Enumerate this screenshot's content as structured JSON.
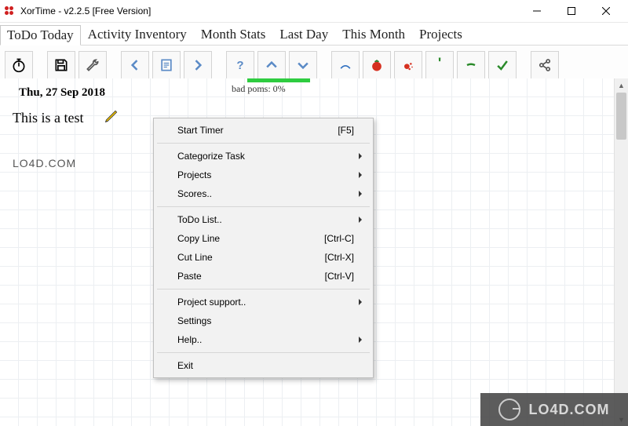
{
  "window": {
    "title": "XorTime - v2.2.5 [Free Version]"
  },
  "tabs": [
    {
      "label": "ToDo Today",
      "active": true
    },
    {
      "label": "Activity Inventory",
      "active": false
    },
    {
      "label": "Month Stats",
      "active": false
    },
    {
      "label": "Last Day",
      "active": false
    },
    {
      "label": "This Month",
      "active": false
    },
    {
      "label": "Projects",
      "active": false
    }
  ],
  "toolbar": {
    "timer": "timer-icon",
    "save": "save-icon",
    "settings": "wrench-icon",
    "prev": "prev-icon",
    "today": "today-icon",
    "next": "next-icon",
    "help": "help-icon",
    "up": "up-icon",
    "down": "down-icon",
    "void": "void-icon",
    "pom": "tomato-icon",
    "bad": "bad-icon",
    "int": "internal-icon",
    "ext": "external-icon",
    "done": "done-icon",
    "share": "share-icon"
  },
  "canvas": {
    "date": "Thu, 27 Sep 2018",
    "task": "This is a test",
    "watermark": "LO4D.COM",
    "poms_label": "bad poms: 0%"
  },
  "context_menu": {
    "items": [
      {
        "label": "Start Timer",
        "accel": "[F5]",
        "type": "item"
      },
      {
        "type": "sep"
      },
      {
        "label": "Categorize Task",
        "type": "sub"
      },
      {
        "label": "Projects",
        "type": "sub"
      },
      {
        "label": "Scores..",
        "type": "sub"
      },
      {
        "type": "sep"
      },
      {
        "label": "ToDo List..",
        "type": "sub"
      },
      {
        "label": "Copy Line",
        "accel": "[Ctrl-C]",
        "type": "item"
      },
      {
        "label": "Cut Line",
        "accel": "[Ctrl-X]",
        "type": "item"
      },
      {
        "label": "Paste",
        "accel": "[Ctrl-V]",
        "type": "item"
      },
      {
        "type": "sep"
      },
      {
        "label": "Project support..",
        "type": "sub"
      },
      {
        "label": "Settings",
        "type": "item"
      },
      {
        "label": "Help..",
        "type": "sub"
      },
      {
        "type": "sep"
      },
      {
        "label": "Exit",
        "type": "item"
      }
    ]
  },
  "brand": {
    "text": "LO4D.COM"
  }
}
